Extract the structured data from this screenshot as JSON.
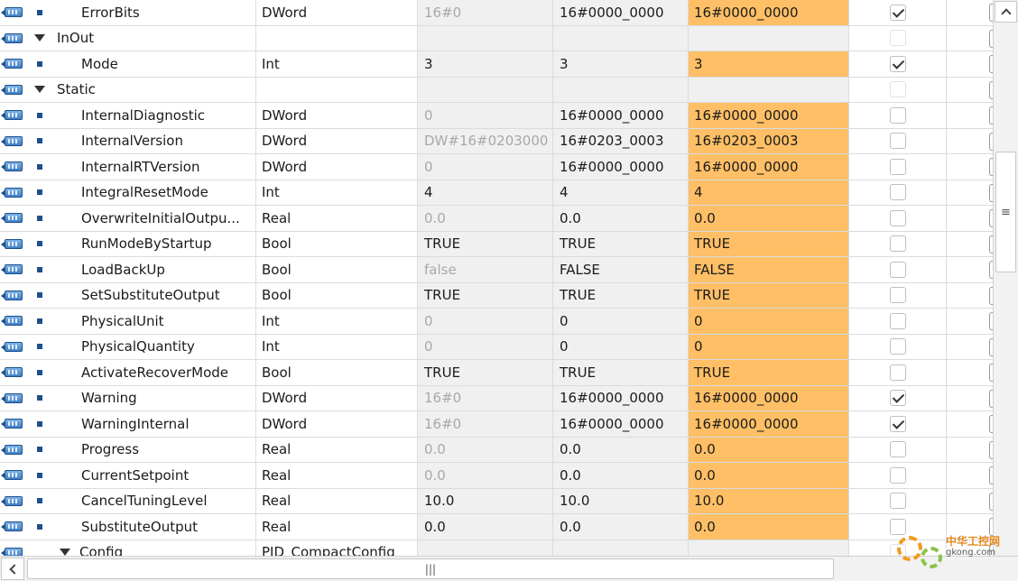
{
  "rows": [
    {
      "kind": "item",
      "name": "ErrorBits",
      "type": "DWord",
      "default": "16#0",
      "start": "16#0000_0000",
      "monitor": "16#0000_0000",
      "checked": true,
      "default_style": "dimmed"
    },
    {
      "kind": "section",
      "name": "InOut",
      "type": "",
      "default": "",
      "start": "",
      "monitor": "",
      "checked": false
    },
    {
      "kind": "item",
      "name": "Mode",
      "type": "Int",
      "default": "3",
      "start": "3",
      "monitor": "3",
      "checked": true,
      "default_style": "actual"
    },
    {
      "kind": "section",
      "name": "Static",
      "type": "",
      "default": "",
      "start": "",
      "monitor": "",
      "checked": false
    },
    {
      "kind": "item",
      "name": "InternalDiagnostic",
      "type": "DWord",
      "default": "0",
      "start": "16#0000_0000",
      "monitor": "16#0000_0000",
      "checked": false,
      "default_style": "dimmed"
    },
    {
      "kind": "item",
      "name": "InternalVersion",
      "type": "DWord",
      "default": "DW#16#0203000",
      "start": "16#0203_0003",
      "monitor": "16#0203_0003",
      "checked": false,
      "default_style": "dimmed"
    },
    {
      "kind": "item",
      "name": "InternalRTVersion",
      "type": "DWord",
      "default": "0",
      "start": "16#0000_0000",
      "monitor": "16#0000_0000",
      "checked": false,
      "default_style": "dimmed"
    },
    {
      "kind": "item",
      "name": "IntegralResetMode",
      "type": "Int",
      "default": "4",
      "start": "4",
      "monitor": "4",
      "checked": false,
      "default_style": "actual"
    },
    {
      "kind": "item",
      "name": "OverwriteInitialOutpu...",
      "type": "Real",
      "default": "0.0",
      "start": "0.0",
      "monitor": "0.0",
      "checked": false,
      "default_style": "dimmed"
    },
    {
      "kind": "item",
      "name": "RunModeByStartup",
      "type": "Bool",
      "default": "TRUE",
      "start": "TRUE",
      "monitor": "TRUE",
      "checked": false,
      "default_style": "actual"
    },
    {
      "kind": "item",
      "name": "LoadBackUp",
      "type": "Bool",
      "default": "false",
      "start": "FALSE",
      "monitor": "FALSE",
      "checked": false,
      "default_style": "dimmed"
    },
    {
      "kind": "item",
      "name": "SetSubstituteOutput",
      "type": "Bool",
      "default": "TRUE",
      "start": "TRUE",
      "monitor": "TRUE",
      "checked": false,
      "default_style": "actual"
    },
    {
      "kind": "item",
      "name": "PhysicalUnit",
      "type": "Int",
      "default": "0",
      "start": "0",
      "monitor": "0",
      "checked": false,
      "default_style": "dimmed"
    },
    {
      "kind": "item",
      "name": "PhysicalQuantity",
      "type": "Int",
      "default": "0",
      "start": "0",
      "monitor": "0",
      "checked": false,
      "default_style": "dimmed"
    },
    {
      "kind": "item",
      "name": "ActivateRecoverMode",
      "type": "Bool",
      "default": "TRUE",
      "start": "TRUE",
      "monitor": "TRUE",
      "checked": false,
      "default_style": "actual"
    },
    {
      "kind": "item",
      "name": "Warning",
      "type": "DWord",
      "default": "16#0",
      "start": "16#0000_0000",
      "monitor": "16#0000_0000",
      "checked": true,
      "default_style": "dimmed"
    },
    {
      "kind": "item",
      "name": "WarningInternal",
      "type": "DWord",
      "default": "16#0",
      "start": "16#0000_0000",
      "monitor": "16#0000_0000",
      "checked": true,
      "default_style": "dimmed"
    },
    {
      "kind": "item",
      "name": "Progress",
      "type": "Real",
      "default": "0.0",
      "start": "0.0",
      "monitor": "0.0",
      "checked": false,
      "default_style": "dimmed"
    },
    {
      "kind": "item",
      "name": "CurrentSetpoint",
      "type": "Real",
      "default": "0.0",
      "start": "0.0",
      "monitor": "0.0",
      "checked": false,
      "default_style": "dimmed"
    },
    {
      "kind": "item",
      "name": "CancelTuningLevel",
      "type": "Real",
      "default": "10.0",
      "start": "10.0",
      "monitor": "10.0",
      "checked": false,
      "default_style": "actual"
    },
    {
      "kind": "item",
      "name": "SubstituteOutput",
      "type": "Real",
      "default": "0.0",
      "start": "0.0",
      "monitor": "0.0",
      "checked": false,
      "default_style": "actual"
    },
    {
      "kind": "subsection",
      "name": "Config",
      "type": "PID_CompactConfig",
      "default": "",
      "start": "",
      "monitor": "",
      "checked": false
    }
  ],
  "colors": {
    "monitor_highlight": "#ffbf66",
    "interface_icon": "#3f7fc4"
  },
  "icons": {
    "row_icon": "interface-parameter-icon",
    "expand": "triangle-down-icon",
    "scroll_grip": "grip-icon"
  },
  "scrollbars": {
    "vertical_grip": "≡",
    "horizontal_grip": "|||"
  },
  "watermark": {
    "line1": "中华工控网",
    "line2": "gkong.com"
  }
}
